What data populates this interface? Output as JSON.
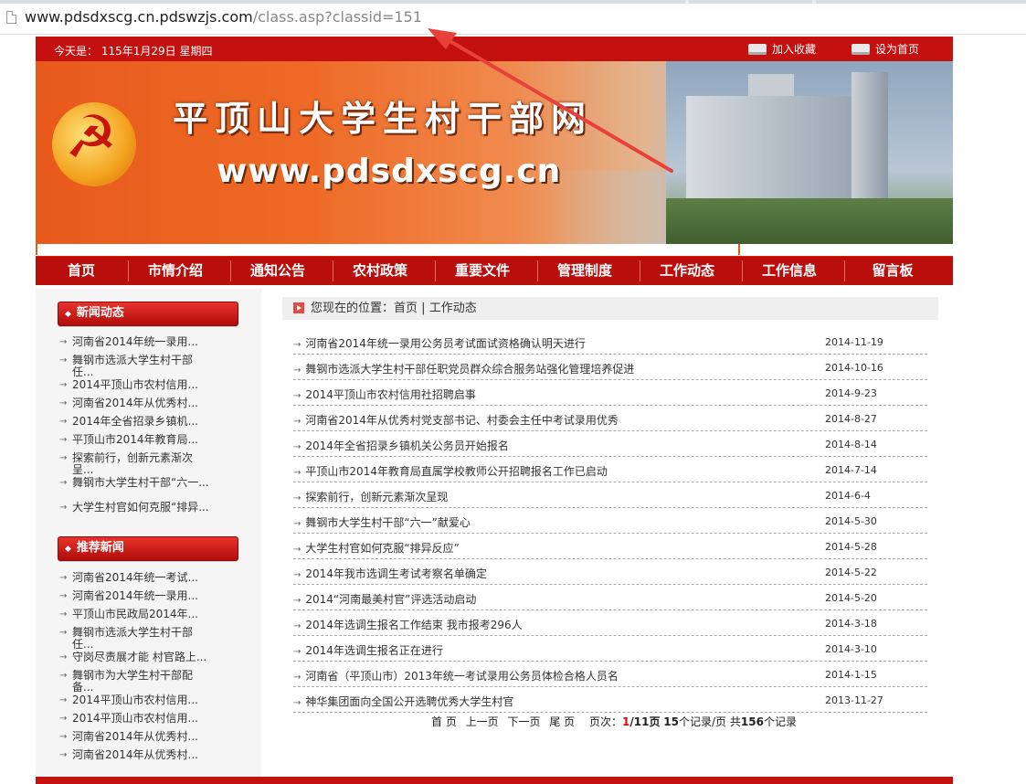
{
  "browser": {
    "url_host": "www.pdsdxscg.cn.pdswzjs.com",
    "url_path": "/class.asp?classid=151"
  },
  "topbar": {
    "date_label": "今天是：",
    "date_value": "115年1月29日 星期四",
    "favorite_label": "加入收藏",
    "homepage_label": "设为首页"
  },
  "banner": {
    "title": "平顶山大学生村干部网",
    "domain": "www.pdsdxscg.cn"
  },
  "nav": {
    "items": [
      "首页",
      "市情介绍",
      "通知公告",
      "农村政策",
      "重要文件",
      "管理制度",
      "工作动态",
      "工作信息",
      "留言板"
    ]
  },
  "sidebar": {
    "news_title": "新闻动态",
    "news_items": [
      "河南省2014年统一录用...",
      "舞钢市选派大学生村干部任...",
      "2014平顶山市农村信用...",
      "河南省2014年从优秀村...",
      "2014年全省招录乡镇机...",
      "平顶山市2014年教育局...",
      "探索前行，创新元素渐次呈...",
      "舞钢市大学生村干部“六一...",
      "大学生村官如何克服“排异..."
    ],
    "recommend_title": "推荐新闻",
    "recommend_items": [
      "河南省2014年统一考试...",
      "河南省2014年统一录用...",
      "平顶山市民政局2014年...",
      "舞钢市选派大学生村干部任...",
      "守岗尽责展才能 村官路上...",
      "舞钢市为大学生村干部配备...",
      "2014平顶山市农村信用...",
      "2014平顶山市农村信用...",
      "河南省2014年从优秀村...",
      "河南省2014年从优秀村..."
    ]
  },
  "breadcrumb": {
    "prefix": "您现在的位置：",
    "home": "首页",
    "sep": "|",
    "current": "工作动态"
  },
  "news": [
    {
      "title": "河南省2014年统一录用公务员考试面试资格确认明天进行",
      "date": "2014-11-19"
    },
    {
      "title": "舞钢市选派大学生村干部任职党员群众综合服务站强化管理培养促进",
      "date": "2014-10-16"
    },
    {
      "title": "2014平顶山市农村信用社招聘启事",
      "date": "2014-9-23"
    },
    {
      "title": "河南省2014年从优秀村党支部书记、村委会主任中考试录用优秀",
      "date": "2014-8-27"
    },
    {
      "title": "2014年全省招录乡镇机关公务员开始报名",
      "date": "2014-8-14"
    },
    {
      "title": "平顶山市2014年教育局直属学校教师公开招聘报名工作已启动",
      "date": "2014-7-14"
    },
    {
      "title": "探索前行，创新元素渐次呈现",
      "date": "2014-6-4"
    },
    {
      "title": "舞钢市大学生村干部“六一”献爱心",
      "date": "2014-5-30"
    },
    {
      "title": "大学生村官如何克服“排异反应”",
      "date": "2014-5-28"
    },
    {
      "title": "2014年我市选调生考试考察名单确定",
      "date": "2014-5-22"
    },
    {
      "title": "2014“河南最美村官”评选活动启动",
      "date": "2014-5-20"
    },
    {
      "title": "2014年选调生报名工作结束 我市报考296人",
      "date": "2014-3-18"
    },
    {
      "title": "2014年选调生报名正在进行",
      "date": "2014-3-10"
    },
    {
      "title": "河南省（平顶山市）2013年统一考试录用公务员体检合格人员名",
      "date": "2014-1-15"
    },
    {
      "title": "神华集团面向全国公开选聘优秀大学生村官",
      "date": "2013-11-27"
    }
  ],
  "pager": {
    "first": "首 页",
    "prev": "上一页",
    "next": "下一页",
    "last": "尾 页",
    "page_label": "页次：",
    "current_page": "1",
    "total_pages": "/11页",
    "per_page": "15",
    "per_page_suffix": "个记录/页",
    "total_prefix": "共",
    "total": "156",
    "total_suffix": "个记录"
  },
  "colors": {
    "brand_red": "#c4100e",
    "annotation_arrow": "#e8403a"
  }
}
